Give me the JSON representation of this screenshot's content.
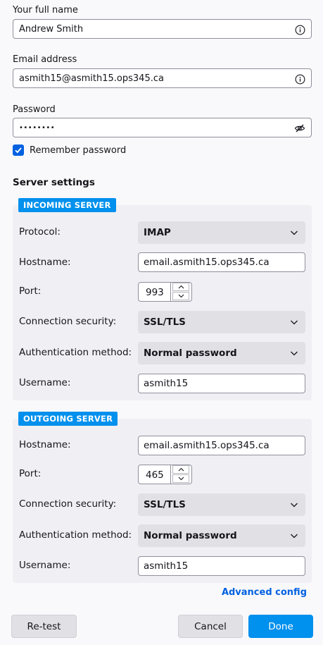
{
  "account": {
    "name_label": "Your full name",
    "name_value": "Andrew Smith",
    "email_label": "Email address",
    "email_value": "asmith15@asmith15.ops345.ca",
    "password_label": "Password",
    "password_value": "••••••••",
    "remember_label": "Remember password",
    "remember_checked": true
  },
  "server_settings_title": "Server settings",
  "incoming": {
    "badge": "INCOMING SERVER",
    "protocol_label": "Protocol:",
    "protocol_value": "IMAP",
    "hostname_label": "Hostname:",
    "hostname_value": "email.asmith15.ops345.ca",
    "port_label": "Port:",
    "port_value": "993",
    "security_label": "Connection security:",
    "security_value": "SSL/TLS",
    "auth_label": "Authentication method:",
    "auth_value": "Normal password",
    "username_label": "Username:",
    "username_value": "asmith15"
  },
  "outgoing": {
    "badge": "OUTGOING SERVER",
    "hostname_label": "Hostname:",
    "hostname_value": "email.asmith15.ops345.ca",
    "port_label": "Port:",
    "port_value": "465",
    "security_label": "Connection security:",
    "security_value": "SSL/TLS",
    "auth_label": "Authentication method:",
    "auth_value": "Normal password",
    "username_label": "Username:",
    "username_value": "asmith15"
  },
  "advanced_config": "Advanced config",
  "buttons": {
    "retest": "Re-test",
    "cancel": "Cancel",
    "done": "Done"
  },
  "colors": {
    "accent": "#0061e0",
    "badge": "#0090ed",
    "primary_button": "#0090ed"
  },
  "icons": {
    "info": "info-icon",
    "eye_slash": "eye-slash-icon",
    "checkmark": "checkmark-icon",
    "chevron": "chevron-down-icon"
  }
}
